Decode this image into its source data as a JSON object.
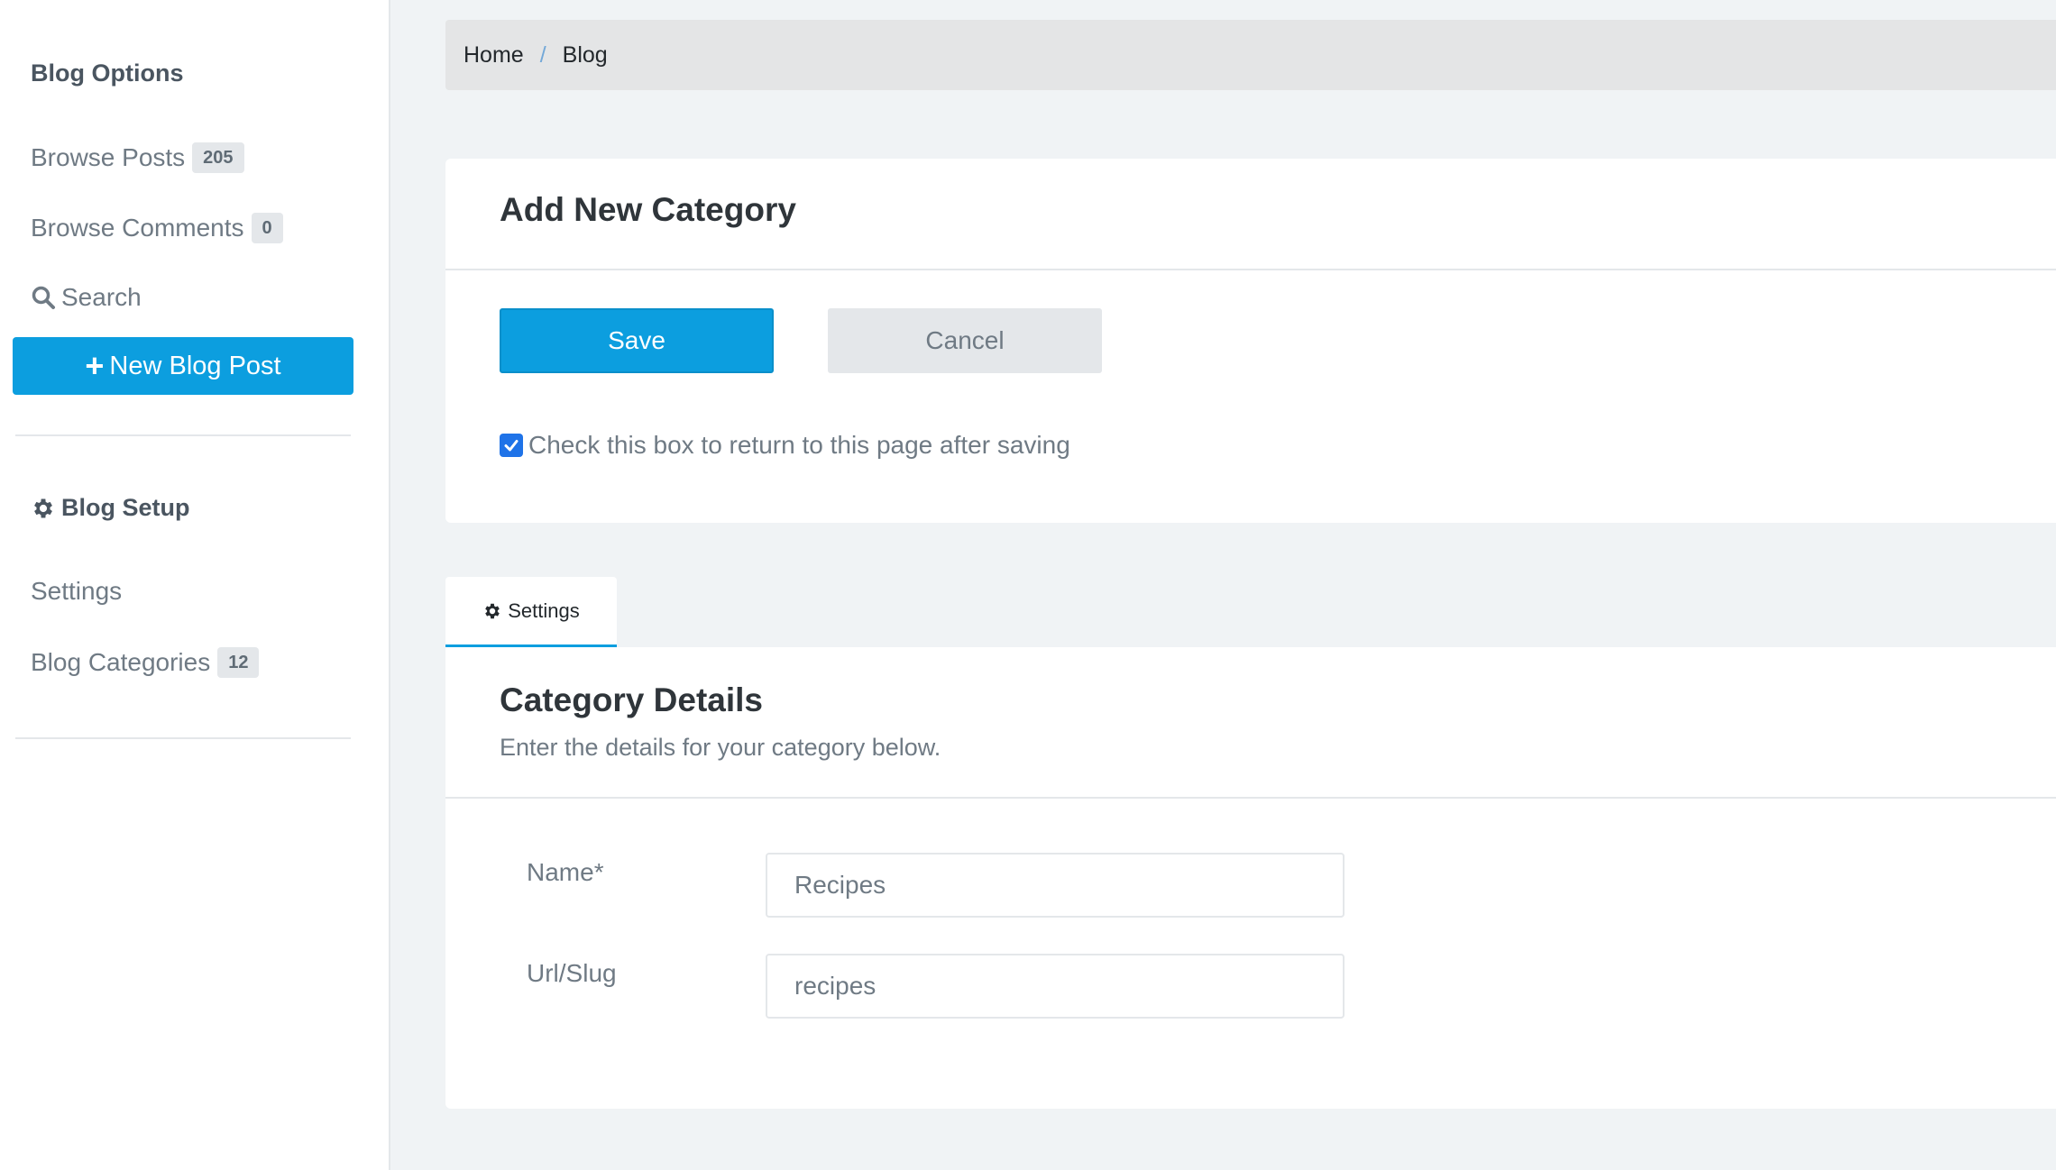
{
  "sidebar": {
    "blog_options_heading": "Blog Options",
    "browse_posts": {
      "label": "Browse Posts",
      "count": "205"
    },
    "browse_comments": {
      "label": "Browse Comments",
      "count": "0"
    },
    "search_label": "Search",
    "new_post_button": "New Blog Post",
    "blog_setup_heading": "Blog Setup",
    "settings_label": "Settings",
    "blog_categories": {
      "label": "Blog Categories",
      "count": "12"
    }
  },
  "breadcrumb": {
    "items": [
      "Home",
      "Blog"
    ],
    "separator": "/"
  },
  "add_category_card": {
    "title": "Add New Category",
    "save_label": "Save",
    "cancel_label": "Cancel",
    "return_checkbox_label": "Check this box to return to this page after saving",
    "return_checkbox_checked": true
  },
  "tabs": [
    {
      "label": "Settings",
      "icon": "gear-icon",
      "active": true
    }
  ],
  "details_card": {
    "title": "Category Details",
    "subtitle": "Enter the details for your category below.",
    "fields": {
      "name": {
        "label": "Name*",
        "value": "Recipes"
      },
      "slug": {
        "label": "Url/Slug",
        "value": "recipes"
      }
    }
  },
  "colors": {
    "primary": "#0c9edf",
    "checkbox": "#1f73e8",
    "page_bg": "#f0f3f5",
    "badge_bg": "#e4e7ea"
  }
}
